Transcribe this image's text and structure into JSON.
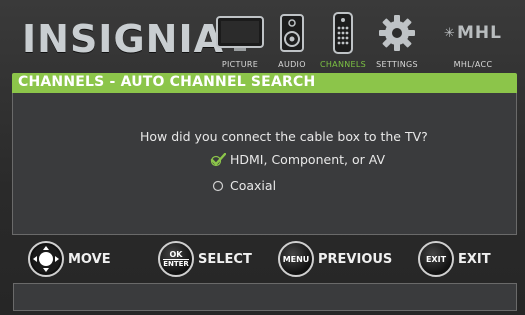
{
  "header": {
    "brand": "INSIGNIA",
    "menu": [
      {
        "label": "PICTURE",
        "icon": "tv-icon",
        "active": false
      },
      {
        "label": "AUDIO",
        "icon": "speaker-icon",
        "active": false
      },
      {
        "label": "CHANNELS",
        "icon": "remote-icon",
        "active": true
      },
      {
        "label": "SETTINGS",
        "icon": "gear-icon",
        "active": false
      },
      {
        "label": "MHL/ACC",
        "icon": "mhl-icon",
        "active": false
      }
    ],
    "mhl_logo": "MHL"
  },
  "panel": {
    "title": "CHANNELS - AUTO CHANNEL SEARCH",
    "question": "How did you connect the cable box to the TV?",
    "options": [
      {
        "label": "HDMI, Component, or AV",
        "selected": true
      },
      {
        "label": "Coaxial",
        "selected": false
      }
    ]
  },
  "hints": [
    {
      "button": "",
      "label": "MOVE",
      "icon": "dpad-icon"
    },
    {
      "button_top": "OK",
      "button_bottom": "ENTER",
      "label": "SELECT"
    },
    {
      "button": "MENU",
      "label": "PREVIOUS"
    },
    {
      "button": "EXIT",
      "label": "EXIT"
    }
  ],
  "colors": {
    "accent": "#8cc54a",
    "active_menu": "#7cc243",
    "panel": "#3a3b3d"
  }
}
